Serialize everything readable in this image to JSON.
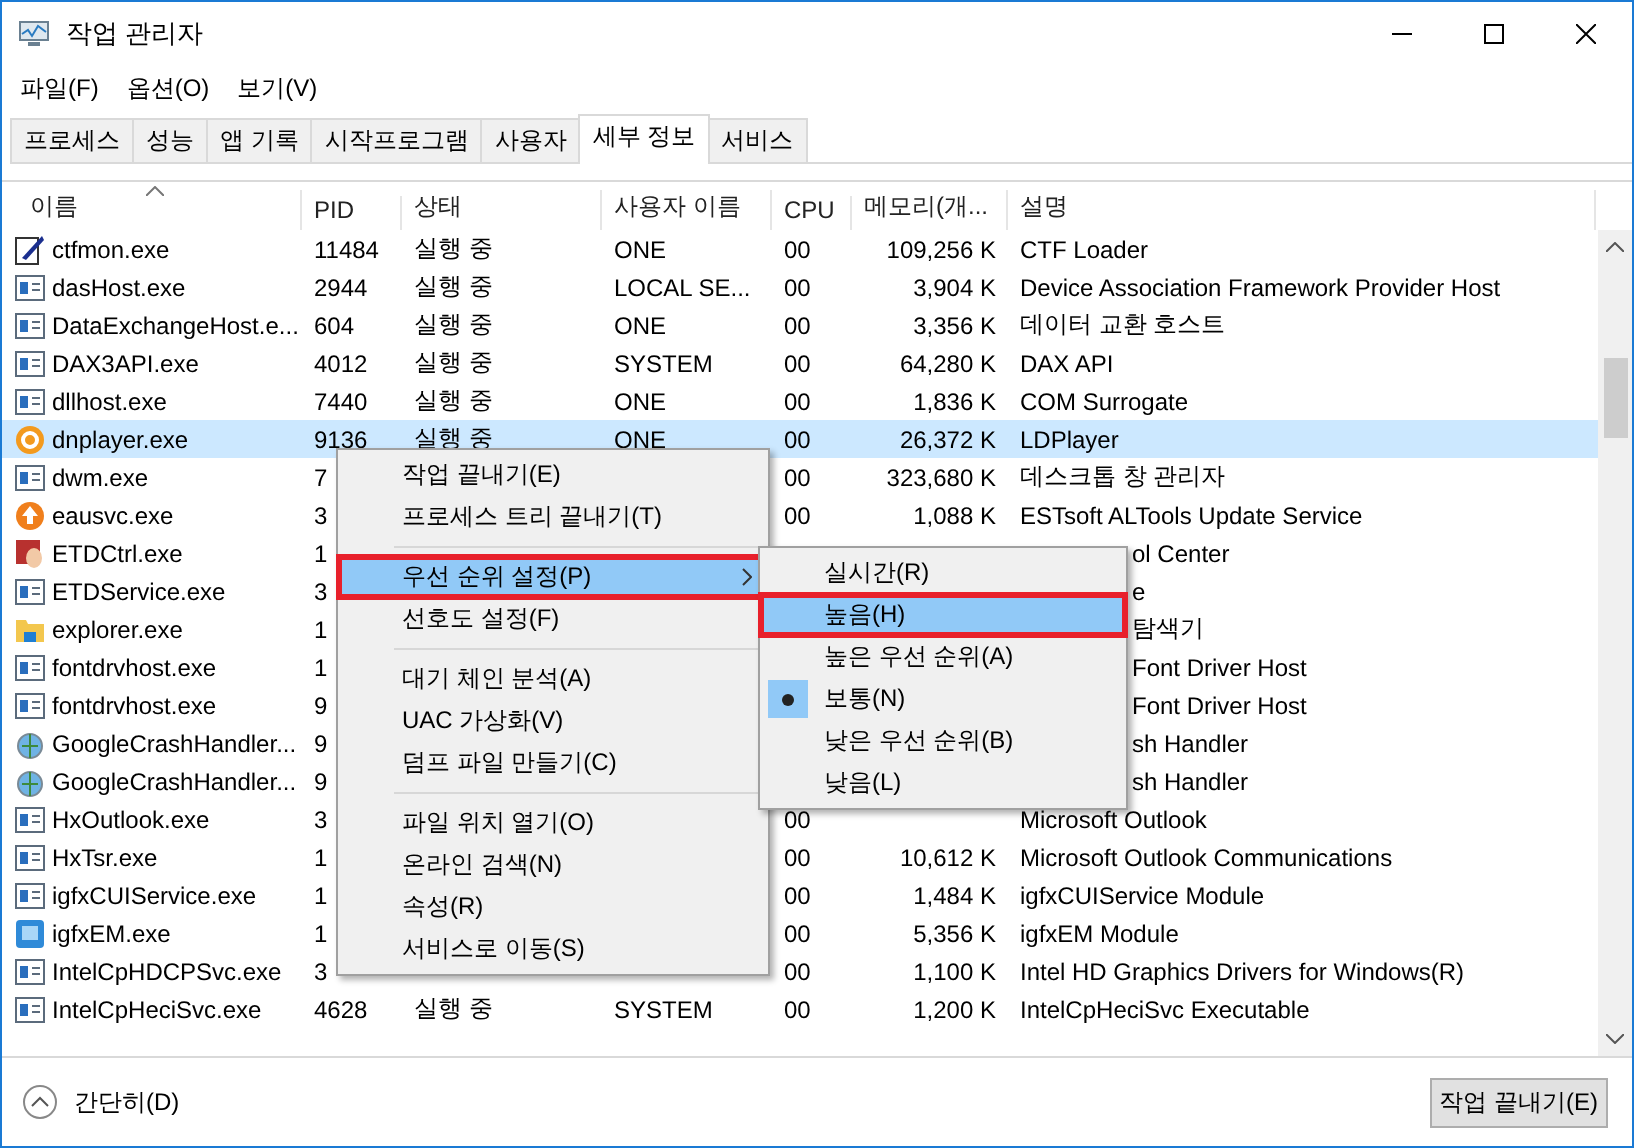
{
  "window": {
    "title": "작업 관리자"
  },
  "menu_bar": [
    "파일(F)",
    "옵션(O)",
    "보기(V)"
  ],
  "tabs": [
    {
      "label": "프로세스",
      "selected": false
    },
    {
      "label": "성능",
      "selected": false
    },
    {
      "label": "앱 기록",
      "selected": false
    },
    {
      "label": "시작프로그램",
      "selected": false
    },
    {
      "label": "사용자",
      "selected": false
    },
    {
      "label": "세부 정보",
      "selected": true
    },
    {
      "label": "서비스",
      "selected": false
    }
  ],
  "table": {
    "columns": [
      "이름",
      "PID",
      "상태",
      "사용자 이름",
      "CPU",
      "메모리(개...",
      "설명"
    ],
    "rows": [
      {
        "kind": "pen",
        "name": "ctfmon.exe",
        "pid": "11484",
        "status": "실행 중",
        "user": "ONE",
        "cpu": "00",
        "memory": "109,256 K",
        "description": "CTF Loader",
        "selected": false
      },
      {
        "kind": "window",
        "name": "dasHost.exe",
        "pid": "2944",
        "status": "실행 중",
        "user": "LOCAL SE...",
        "cpu": "00",
        "memory": "3,904 K",
        "description": "Device Association Framework Provider Host",
        "selected": false
      },
      {
        "kind": "window",
        "name": "DataExchangeHost.e...",
        "pid": "604",
        "status": "실행 중",
        "user": "ONE",
        "cpu": "00",
        "memory": "3,356 K",
        "description": "데이터 교환 호스트",
        "selected": false
      },
      {
        "kind": "window",
        "name": "DAX3API.exe",
        "pid": "4012",
        "status": "실행 중",
        "user": "SYSTEM",
        "cpu": "00",
        "memory": "64,280 K",
        "description": "DAX API",
        "selected": false
      },
      {
        "kind": "window",
        "name": "dllhost.exe",
        "pid": "7440",
        "status": "실행 중",
        "user": "ONE",
        "cpu": "00",
        "memory": "1,836 K",
        "description": "COM Surrogate",
        "selected": false
      },
      {
        "kind": "ring",
        "name": "dnplayer.exe",
        "pid": "9136",
        "status": "실행 중",
        "user": "ONE",
        "cpu": "00",
        "memory": "26,372 K",
        "description": "LDPlayer",
        "selected": true
      },
      {
        "kind": "window",
        "name": "dwm.exe",
        "pid": "7",
        "cpu": "00",
        "memory": "323,680 K",
        "description": "데스크톱 창 관리자",
        "selected": false
      },
      {
        "kind": "up",
        "name": "eausvc.exe",
        "pid": "3",
        "cpu": "00",
        "memory": "1,088 K",
        "description": "ESTsoft ALTools Update Service",
        "selected": false
      },
      {
        "kind": "hand",
        "name": "ETDCtrl.exe",
        "pid": "1",
        "description": "ol Center",
        "selected": false
      },
      {
        "kind": "window",
        "name": "ETDService.exe",
        "pid": "3",
        "description": "e",
        "selected": false
      },
      {
        "kind": "folder",
        "name": "explorer.exe",
        "pid": "1",
        "description": "탐색기",
        "selected": false
      },
      {
        "kind": "window",
        "name": "fontdrvhost.exe",
        "pid": "1",
        "description": "Font Driver Host",
        "selected": false
      },
      {
        "kind": "window",
        "name": "fontdrvhost.exe",
        "pid": "9",
        "description": "Font Driver Host",
        "selected": false
      },
      {
        "kind": "globe",
        "name": "GoogleCrashHandler...",
        "pid": "9",
        "description": "sh Handler",
        "selected": false
      },
      {
        "kind": "globe",
        "name": "GoogleCrashHandler...",
        "pid": "9",
        "description": "sh Handler",
        "selected": false
      },
      {
        "kind": "window",
        "name": "HxOutlook.exe",
        "pid": "3",
        "cpu": "00",
        "description": "Microsoft Outlook",
        "selected": false
      },
      {
        "kind": "window",
        "name": "HxTsr.exe",
        "pid": "1",
        "cpu": "00",
        "memory": "10,612 K",
        "description": "Microsoft Outlook Communications",
        "selected": false
      },
      {
        "kind": "window",
        "name": "igfxCUIService.exe",
        "pid": "1",
        "cpu": "00",
        "memory": "1,484 K",
        "description": "igfxCUIService Module",
        "selected": false
      },
      {
        "kind": "screen",
        "name": "igfxEM.exe",
        "pid": "1",
        "cpu": "00",
        "memory": "5,356 K",
        "description": "igfxEM Module",
        "selected": false
      },
      {
        "kind": "window",
        "name": "IntelCpHDCPSvc.exe",
        "pid": "3",
        "cpu": "00",
        "memory": "1,100 K",
        "description": "Intel HD Graphics Drivers for Windows(R)",
        "selected": false
      },
      {
        "kind": "window",
        "name": "IntelCpHeciSvc.exe",
        "pid": "4628",
        "status": "실행 중",
        "user": "SYSTEM",
        "cpu": "00",
        "memory": "1,200 K",
        "description": "IntelCpHeciSvc Executable",
        "selected": false
      }
    ]
  },
  "context_menu": {
    "groups": [
      [
        {
          "label": "작업 끝내기(E)",
          "selected": false,
          "outlined": false
        },
        {
          "label": "프로세스 트리 끝내기(T)",
          "selected": false,
          "outlined": false
        }
      ],
      [
        {
          "label": "우선 순위 설정(P)",
          "selected": true,
          "outlined": true,
          "submenu": true
        },
        {
          "label": "선호도 설정(F)",
          "selected": false,
          "outlined": false
        }
      ],
      [
        {
          "label": "대기 체인 분석(A)",
          "selected": false,
          "outlined": false
        },
        {
          "label": "UAC 가상화(V)",
          "selected": false,
          "outlined": false
        },
        {
          "label": "덤프 파일 만들기(C)",
          "selected": false,
          "outlined": false
        }
      ],
      [
        {
          "label": "파일 위치 열기(O)",
          "selected": false,
          "outlined": false
        },
        {
          "label": "온라인 검색(N)",
          "selected": false,
          "outlined": false
        },
        {
          "label": "속성(R)",
          "selected": false,
          "outlined": false
        },
        {
          "label": "서비스로 이동(S)",
          "selected": false,
          "outlined": false
        }
      ]
    ]
  },
  "submenu": [
    {
      "label": "실시간(R)",
      "selected": false,
      "outlined": false,
      "checked": false
    },
    {
      "label": "높음(H)",
      "selected": true,
      "outlined": true,
      "checked": false
    },
    {
      "label": "높은 우선 순위(A)",
      "selected": false,
      "outlined": false,
      "checked": false
    },
    {
      "label": "보통(N)",
      "selected": false,
      "outlined": false,
      "checked": true
    },
    {
      "label": "낮은 우선 순위(B)",
      "selected": false,
      "outlined": false,
      "checked": false
    },
    {
      "label": "낮음(L)",
      "selected": false,
      "outlined": false,
      "checked": false
    }
  ],
  "footer": {
    "toggle": "간단히(D)",
    "button": "작업 끝내기(E)"
  }
}
